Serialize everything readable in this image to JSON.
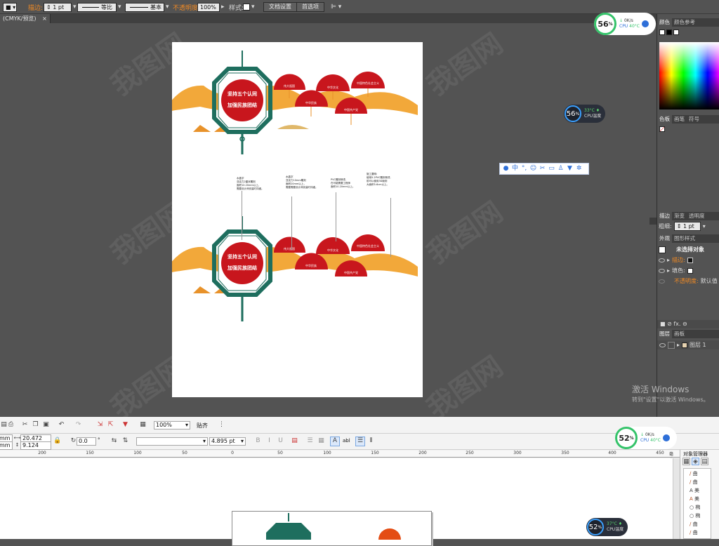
{
  "ai_control_bar": {
    "stroke_label": "描边:",
    "stroke_weight": "1 pt",
    "stroke_profile": "等比",
    "brush": "基本",
    "opacity_label": "不透明度",
    "opacity_value": "100%",
    "style_label": "样式:",
    "doc_setup_button": "文档设置",
    "prefs_button": "首选项"
  },
  "doc_tab": {
    "title": "(CMYK/预览)",
    "close": "×"
  },
  "artboard": {
    "notes_upper": [
      "水晶字\n亚克力2厘米雕刻\n面积10.20mm以上，\n需要设计师安装时详细。",
      "水晶字\n亚克力10mm雕刻\n面积20mm以上，\n需要需要设计师安装时详细。",
      "PVC雕刻喷漆,\n在可能需要工程师\n面积10.20mm以上。",
      "施工要明:\n使用5.2PVC雕刻喷漆,\n前可以使用3D版刻\n大面积5-6cm以上。"
    ],
    "lantern_text": "坚持五个认同 加强民族团结",
    "fans": [
      {
        "badge": "认同",
        "text": "伟大祖国"
      },
      {
        "badge": "认同",
        "text": "中华民族"
      },
      {
        "badge": "认同",
        "text": "中华文化"
      },
      {
        "badge": "认同",
        "text": "中国共产党"
      },
      {
        "badge": "认同",
        "text": "中国特色社会主义"
      }
    ]
  },
  "right_panel": {
    "tabs_color": [
      "颜色",
      "颜色参考"
    ],
    "tabs_swatches": [
      "色板",
      "画笔",
      "符号"
    ],
    "tabs_stroke": [
      "描边",
      "渐变",
      "透明度"
    ],
    "stroke_weight_label": "粗细:",
    "stroke_weight_value": "1 pt",
    "tabs_appearance": [
      "外观",
      "图形样式"
    ],
    "appearance_title": "未选择对象",
    "appearance_stroke": "描边:",
    "appearance_fill": "填色:",
    "appearance_opacity": "不透明度:",
    "appearance_opacity_value": "默认值",
    "tabs_layers": [
      "图层",
      "画板"
    ],
    "layer_name": "图层 1"
  },
  "cpu_widgets": [
    {
      "percent": "56",
      "unit": "%",
      "speed": "0K/s",
      "label": "CPU",
      "temp": "40°C"
    },
    {
      "percent": "56",
      "unit": "%",
      "temp": "33°C",
      "label": "CPU温度"
    },
    {
      "percent": "52",
      "unit": "%",
      "speed": "0K/s",
      "label": "CPU",
      "temp": "40°C"
    },
    {
      "percent": "52",
      "unit": "%",
      "temp": "37°C",
      "label": "CPU温度"
    }
  ],
  "float_toolbar": {
    "lang": "中"
  },
  "windows_activation": {
    "title": "激活 Windows",
    "subtitle": "转到\"设置\"以激活 Windows。"
  },
  "coreldraw": {
    "zoom": "100%",
    "snap": "贴齐",
    "width": "20.472 mm",
    "height": "9.124 mm",
    "pos_x": "mm",
    "pos_y": "mm",
    "angle": "0.0",
    "angle_unit": "°",
    "outline": "4.895 pt",
    "text_btn": "abl",
    "object_manager_title": "对象管理器",
    "ruler_labels": [
      "200",
      "150",
      "100",
      "50",
      "0",
      "50",
      "100",
      "150",
      "200",
      "250",
      "300",
      "350",
      "400",
      "450"
    ],
    "ruler_unit": "毫米",
    "object_items": [
      "曲",
      "曲",
      "美",
      "美",
      "椭",
      "椭",
      "曲",
      "曲"
    ]
  },
  "watermark_text": "我图网"
}
